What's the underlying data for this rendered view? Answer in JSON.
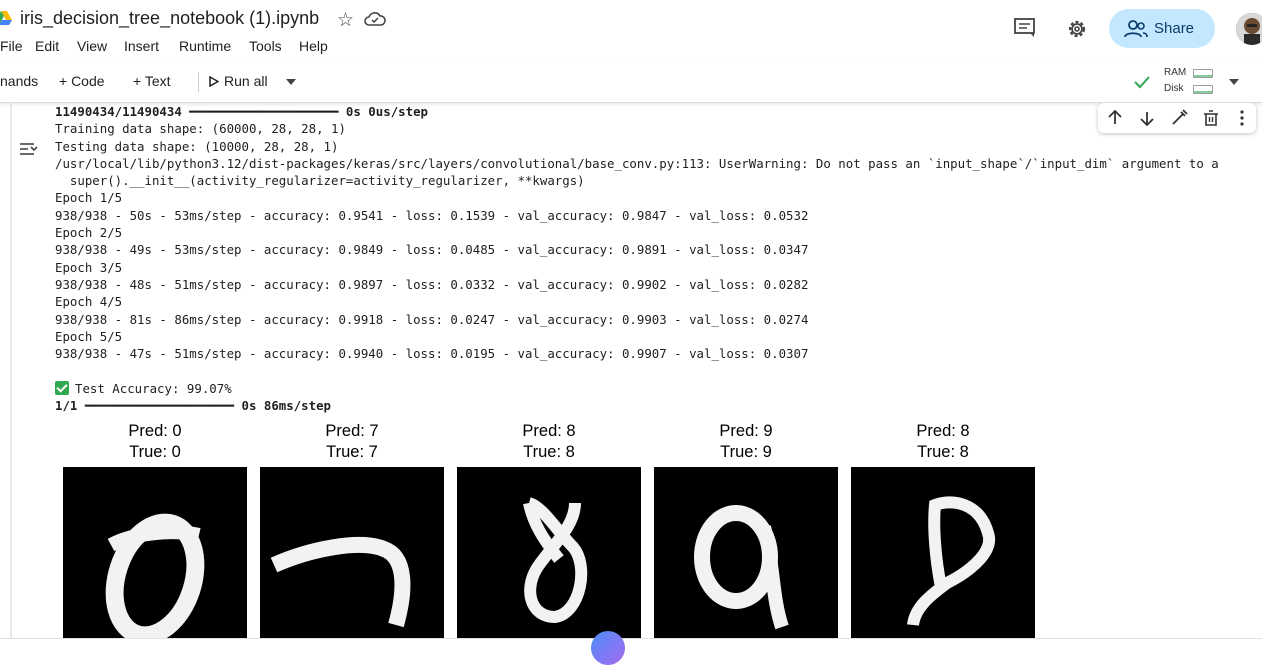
{
  "header": {
    "title": "iris_decision_tree_notebook (1).ipynb",
    "share_label": "Share",
    "menu": [
      "File",
      "Edit",
      "View",
      "Insert",
      "Runtime",
      "Tools",
      "Help"
    ]
  },
  "toolbar": {
    "commands_label": "nands",
    "code_label": "+ Code",
    "text_label": "+ Text",
    "run_all_label": "Run all",
    "ram_label": "RAM",
    "disk_label": "Disk"
  },
  "output": {
    "lines": [
      {
        "text": "11490434/11490434 ━━━━━━━━━━━━━━━━━━━━ 0s 0us/step",
        "bold": true
      },
      {
        "text": "Training data shape: (60000, 28, 28, 1)"
      },
      {
        "text": "Testing data shape: (10000, 28, 28, 1)"
      },
      {
        "text": "/usr/local/lib/python3.12/dist-packages/keras/src/layers/convolutional/base_conv.py:113: UserWarning: Do not pass an `input_shape`/`input_dim` argument to a"
      },
      {
        "text": "  super().__init__(activity_regularizer=activity_regularizer, **kwargs)"
      },
      {
        "text": "Epoch 1/5"
      },
      {
        "text": "938/938 - 50s - 53ms/step - accuracy: 0.9541 - loss: 0.1539 - val_accuracy: 0.9847 - val_loss: 0.0532"
      },
      {
        "text": "Epoch 2/5"
      },
      {
        "text": "938/938 - 49s - 53ms/step - accuracy: 0.9849 - loss: 0.0485 - val_accuracy: 0.9891 - val_loss: 0.0347"
      },
      {
        "text": "Epoch 3/5"
      },
      {
        "text": "938/938 - 48s - 51ms/step - accuracy: 0.9897 - loss: 0.0332 - val_accuracy: 0.9902 - val_loss: 0.0282"
      },
      {
        "text": "Epoch 4/5"
      },
      {
        "text": "938/938 - 81s - 86ms/step - accuracy: 0.9918 - loss: 0.0247 - val_accuracy: 0.9903 - val_loss: 0.0274"
      },
      {
        "text": "Epoch 5/5"
      },
      {
        "text": "938/938 - 47s - 51ms/step - accuracy: 0.9940 - loss: 0.0195 - val_accuracy: 0.9907 - val_loss: 0.0307"
      },
      {
        "text": ""
      },
      {
        "text": "Test Accuracy: 99.07%",
        "check": true
      },
      {
        "text": "1/1 ━━━━━━━━━━━━━━━━━━━━ 0s 86ms/step",
        "bold_prefix": "1/1",
        "bold_bar": true
      }
    ]
  },
  "predictions": [
    {
      "pred": "Pred: 0",
      "true": "True: 0",
      "digit": "0"
    },
    {
      "pred": "Pred: 7",
      "true": "True: 7",
      "digit": "7"
    },
    {
      "pred": "Pred: 8",
      "true": "True: 8",
      "digit": "8"
    },
    {
      "pred": "Pred: 9",
      "true": "True: 9",
      "digit": "9"
    },
    {
      "pred": "Pred: 8",
      "true": "True: 8",
      "digit": "8"
    }
  ],
  "colors": {
    "share_bg": "#c2e7ff",
    "check_green": "#2fa84f",
    "accent_blue": "#1a73e8"
  }
}
